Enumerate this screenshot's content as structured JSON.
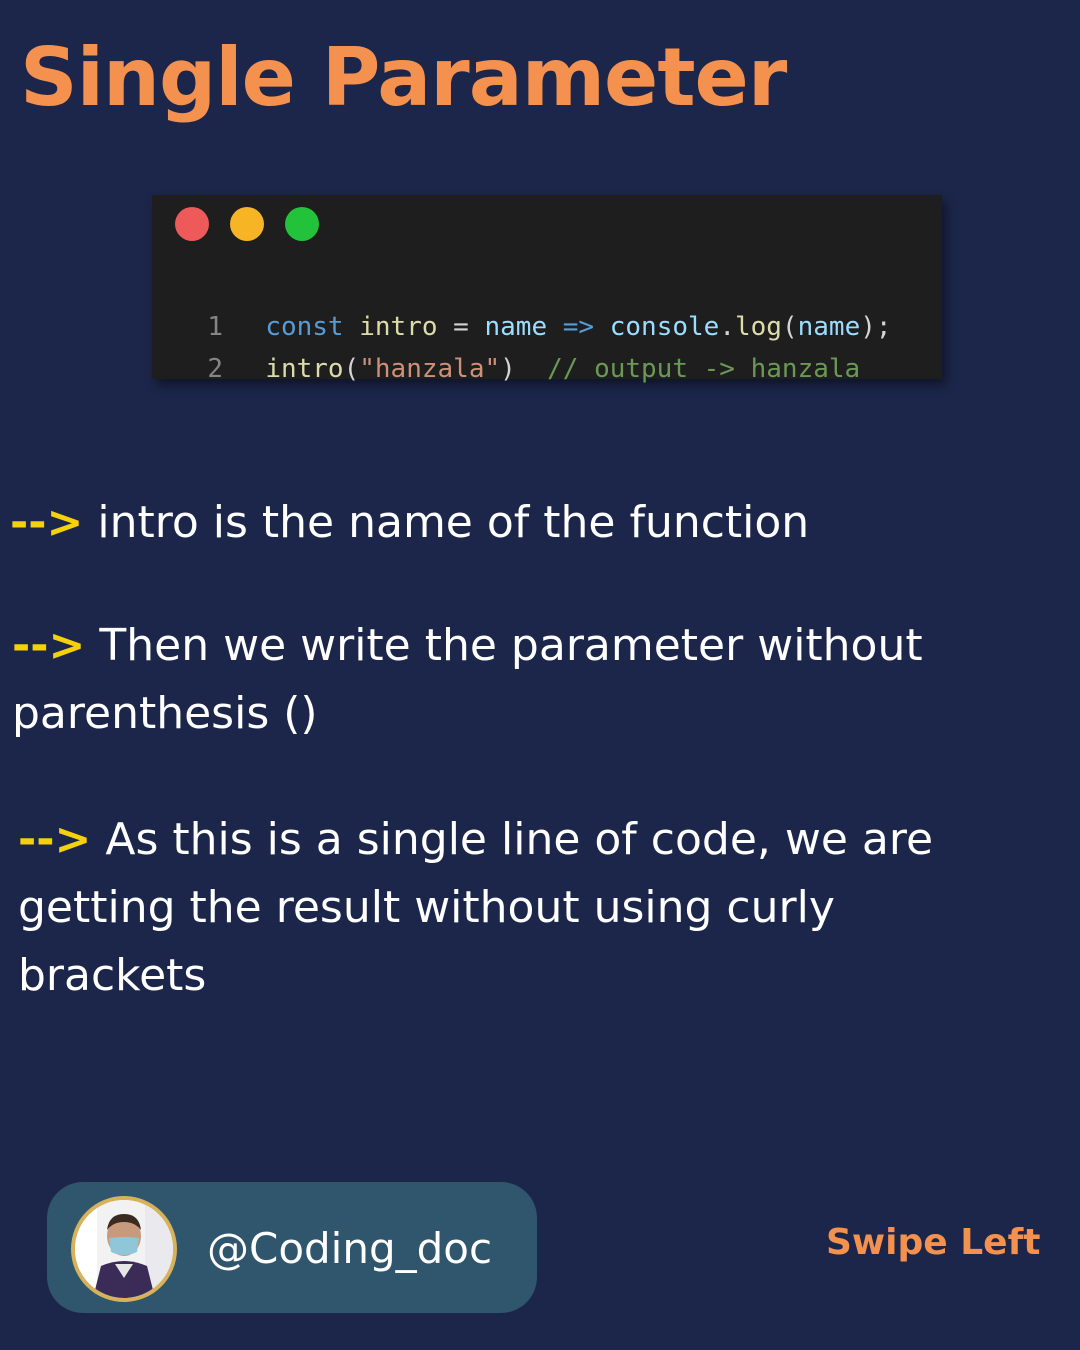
{
  "title": "Single Parameter",
  "code_window": {
    "buttons": [
      {
        "name": "close",
        "color": "#ee5a5a"
      },
      {
        "name": "minimize",
        "color": "#f7b425"
      },
      {
        "name": "maximize",
        "color": "#22c33a"
      }
    ],
    "lines": [
      {
        "number": "1",
        "tokens": [
          {
            "text": "const",
            "color": "#569cd6"
          },
          {
            "text": " ",
            "color": "#d4d4d4"
          },
          {
            "text": "intro",
            "color": "#dcdcaa"
          },
          {
            "text": " = ",
            "color": "#d4d4d4"
          },
          {
            "text": "name",
            "color": "#9cdcfe"
          },
          {
            "text": " ",
            "color": "#d4d4d4"
          },
          {
            "text": "=>",
            "color": "#569cd6"
          },
          {
            "text": " ",
            "color": "#d4d4d4"
          },
          {
            "text": "console",
            "color": "#9cdcfe"
          },
          {
            "text": ".",
            "color": "#d4d4d4"
          },
          {
            "text": "log",
            "color": "#dcdcaa"
          },
          {
            "text": "(",
            "color": "#d4d4d4"
          },
          {
            "text": "name",
            "color": "#9cdcfe"
          },
          {
            "text": ");",
            "color": "#d4d4d4"
          }
        ]
      },
      {
        "number": "2",
        "tokens": [
          {
            "text": "intro",
            "color": "#dcdcaa"
          },
          {
            "text": "(",
            "color": "#d4d4d4"
          },
          {
            "text": "\"hanzala\"",
            "color": "#ce9178"
          },
          {
            "text": ")  ",
            "color": "#d4d4d4"
          },
          {
            "text": "// output -> hanzala",
            "color": "#6a9955"
          }
        ]
      }
    ]
  },
  "points": [
    {
      "arrow": "-->",
      "text": " intro is the name of the function"
    },
    {
      "arrow": "-->",
      "text": " Then we write the parameter without parenthesis ()"
    },
    {
      "arrow": "-->",
      "text": " As this is a single line of code, we are getting the result without using curly brackets"
    }
  ],
  "footer": {
    "handle": "@Coding_doc",
    "swipe_label": "Swipe Left"
  },
  "colors": {
    "background": "#1b264a",
    "accent_orange": "#f5914e",
    "arrow_yellow": "#f5d10c",
    "pill": "#2f566c"
  }
}
